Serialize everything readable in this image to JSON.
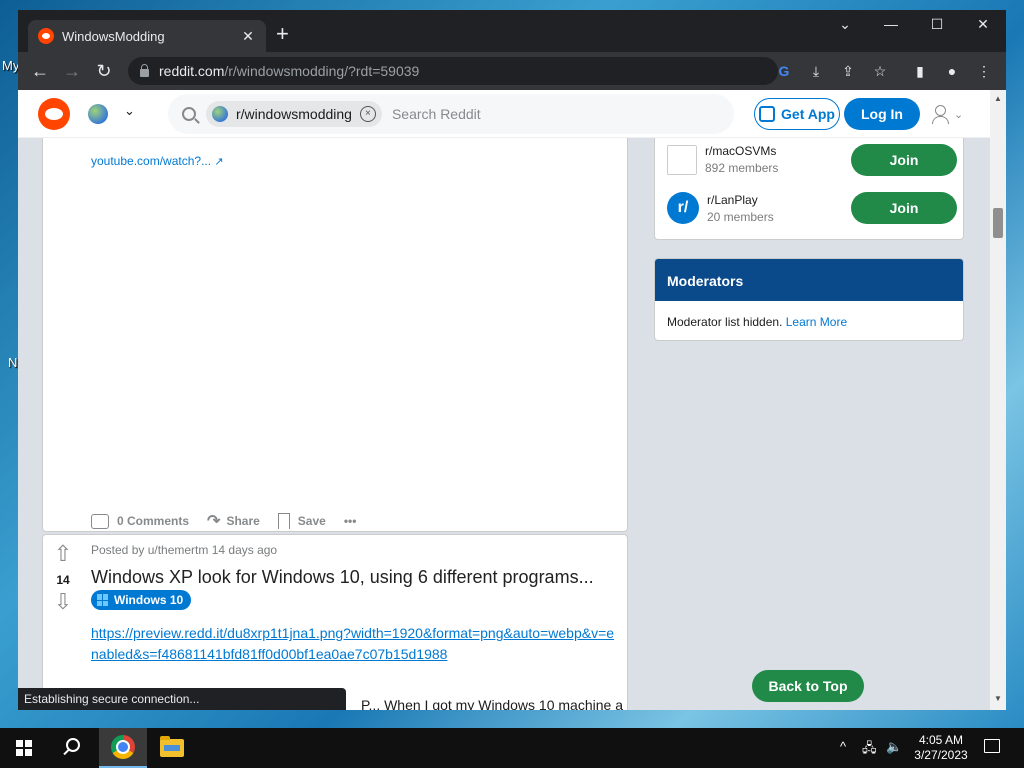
{
  "desktop": {
    "label1": "My",
    "label2": "N"
  },
  "browser": {
    "tab_title": "WindowsModding",
    "tab_close": "✕",
    "new_tab": "+",
    "win_minimize": "—",
    "win_maximize": "☐",
    "win_close": "✕",
    "win_menu": "⌄",
    "url_host": "reddit.com",
    "url_path": "/r/windowsmodding/?rdt=59039",
    "status_text": "Establishing secure connection..."
  },
  "reddit": {
    "search_chip": "r/windowsmodding",
    "search_placeholder": "Search Reddit",
    "get_app": "Get App",
    "login": "Log In",
    "post1": {
      "link": "youtube.com/watch?...",
      "comments": "0 Comments",
      "share": "Share",
      "save": "Save",
      "more": "•••"
    },
    "post2": {
      "score": "14",
      "meta": "Posted by u/themertm 14 days ago",
      "title": "Windows XP look for Windows 10, using 6 different programs...",
      "flair": "Windows 10",
      "link": "https://preview.redd.it/du8xrp1t1jna1.png?width=1920&format=png&auto=webp&v=enabled&s=f48681141bfd81ff0d00bf1ea0ae7c07b15d1988",
      "body_snippet": "P... When I got my Windows 10 machine a"
    },
    "communities": [
      {
        "name": "r/macOSVMs",
        "members": "892 members",
        "join": "Join"
      },
      {
        "name": "r/LanPlay",
        "members": "20 members",
        "join": "Join",
        "avatar_letter": "r/"
      }
    ],
    "moderators": {
      "title": "Moderators",
      "text": "Moderator list hidden.",
      "link": "Learn More"
    },
    "back_to_top": "Back to Top"
  },
  "taskbar": {
    "time": "4:05 AM",
    "date": "3/27/2023",
    "tray_chevron": "^"
  },
  "colors": {
    "reddit_orange": "#ff4500",
    "reddit_blue": "#0079d3",
    "join_green": "#218a48",
    "mod_header": "#0a4a8a"
  }
}
